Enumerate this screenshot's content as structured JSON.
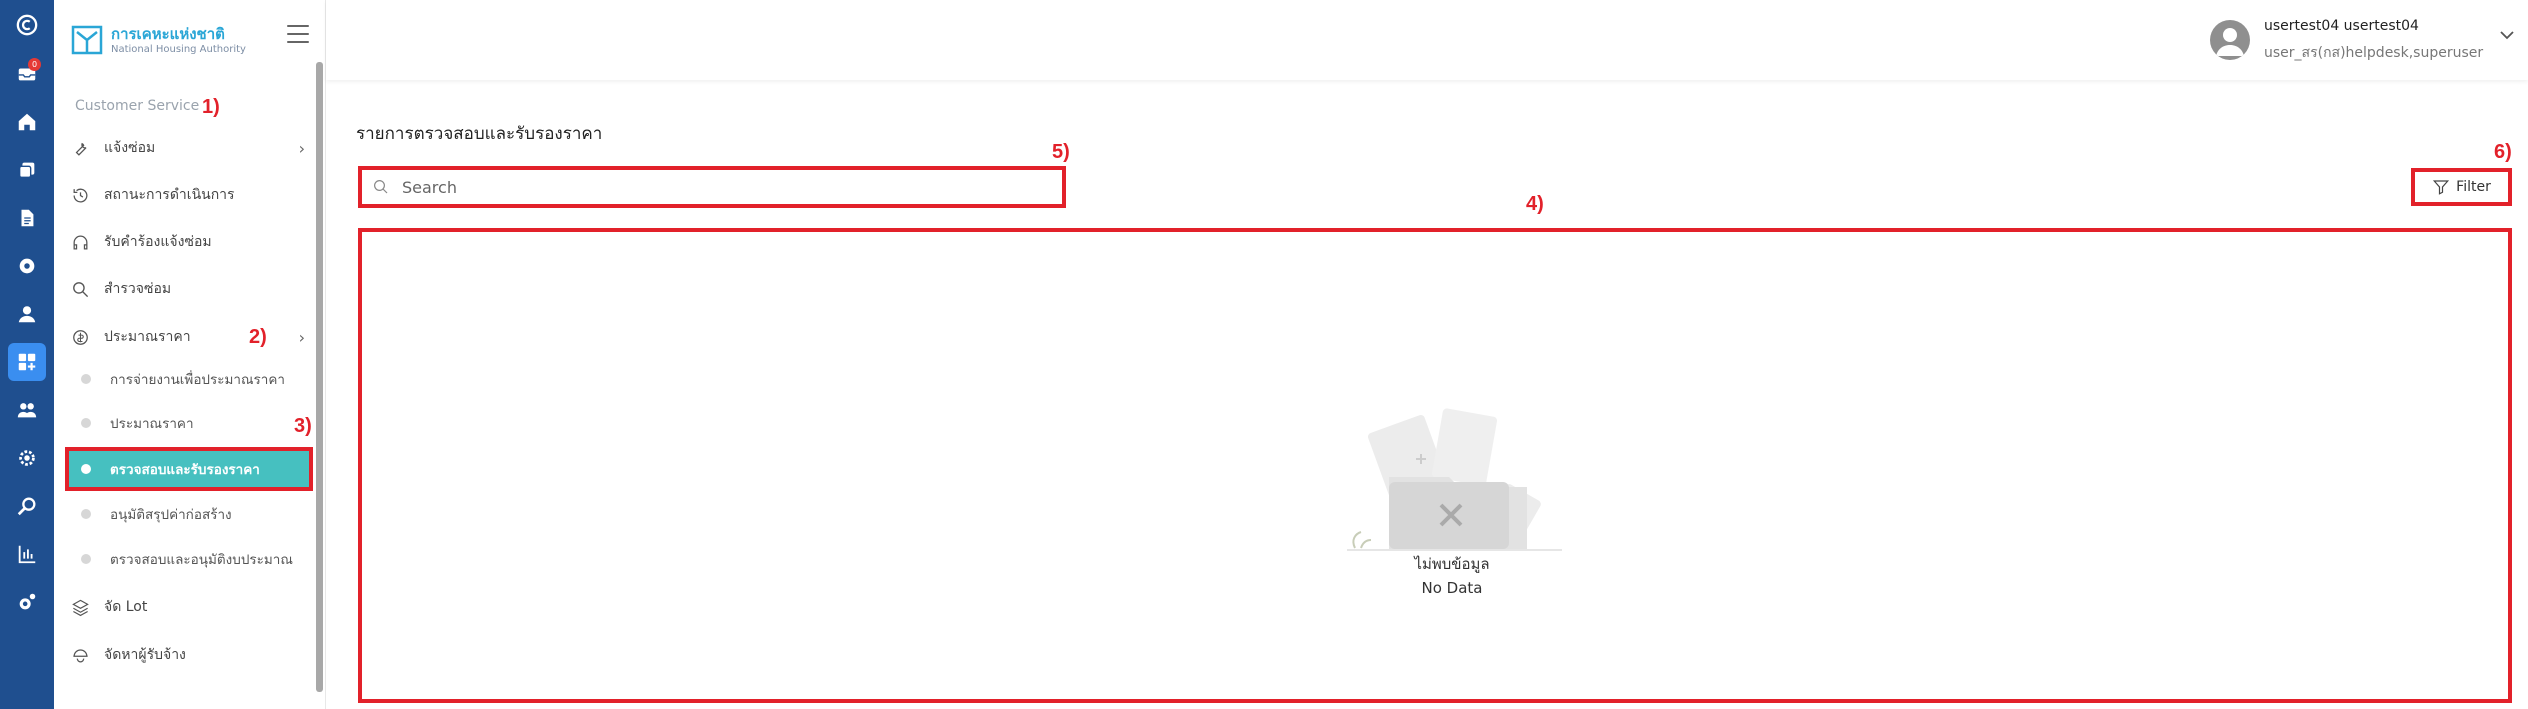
{
  "rail": {
    "badge_count": "0"
  },
  "logo": {
    "th": "การเคหะแห่งชาติ",
    "en": "National Housing Authority"
  },
  "sidebar": {
    "section_title": "Customer Service",
    "items": [
      {
        "label": "แจ้งซ่อม",
        "icon": "wrench-icon"
      },
      {
        "label": "สถานะการดำเนินการ",
        "icon": "history-icon"
      },
      {
        "label": "รับคำร้องแจ้งซ่อม",
        "icon": "headset-icon"
      },
      {
        "label": "สำรวจซ่อม",
        "icon": "search-icon"
      },
      {
        "label": "ประมาณราคา",
        "icon": "coin-icon"
      }
    ],
    "sub_items": [
      {
        "label": "การจ่ายงานเพื่อประมาณราคา"
      },
      {
        "label": "ประมาณราคา"
      },
      {
        "label": "ตรวจสอบและรับรองราคา"
      },
      {
        "label": "อนุมัติสรุปค่าก่อสร้าง"
      },
      {
        "label": "ตรวจสอบและอนุมัติงบประมาณ"
      }
    ],
    "bottom_items": [
      {
        "label": "จัด Lot",
        "icon": "layers-icon"
      },
      {
        "label": "จัดหาผู้รับจ้าง",
        "icon": "contractor-icon"
      }
    ]
  },
  "annotations": {
    "a1": "1)",
    "a2": "2)",
    "a3": "3)",
    "a4": "4)",
    "a5": "5)",
    "a6": "6)"
  },
  "user": {
    "name": "usertest04 usertest04",
    "role": "user_สร(กส)helpdesk,superuser"
  },
  "main": {
    "title": "รายการตรวจสอบและรับรองราคา",
    "search_placeholder": "Search",
    "filter_label": "Filter",
    "empty_th": "ไม่พบข้อมูล",
    "empty_en": "No Data"
  },
  "colors": {
    "rail": "#1f4f8f",
    "active_sub": "#46c0c0",
    "annotation": "#e2212a"
  }
}
